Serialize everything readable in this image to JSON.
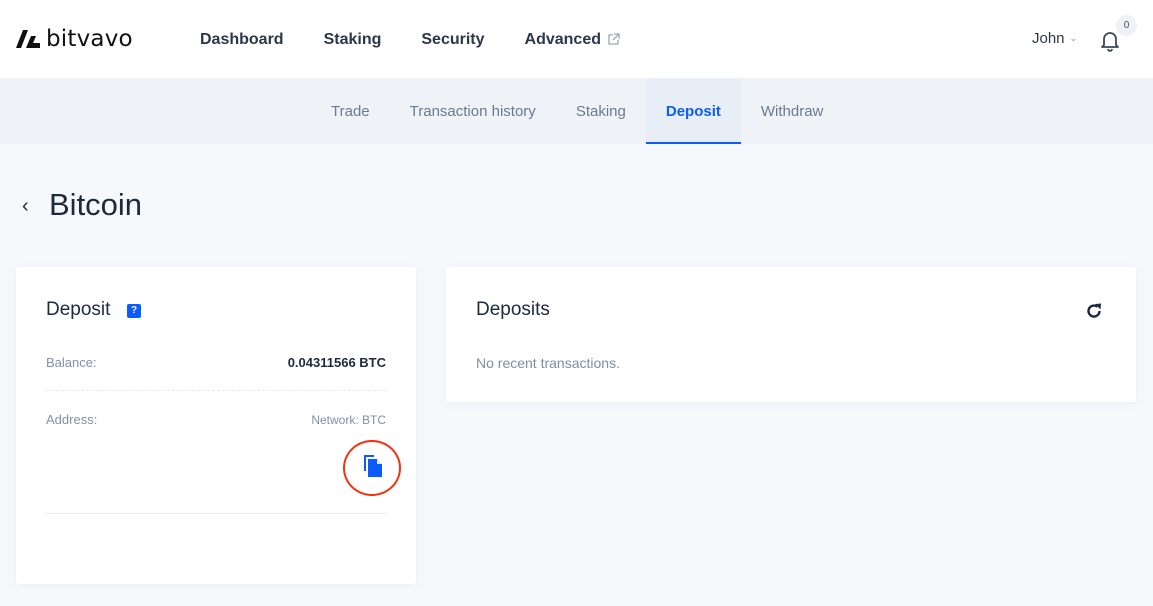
{
  "header": {
    "brand": "bitvavo",
    "nav": [
      {
        "label": "Dashboard"
      },
      {
        "label": "Staking"
      },
      {
        "label": "Security"
      },
      {
        "label": "Advanced",
        "icon": "external-link-icon"
      }
    ],
    "user": {
      "name": "John",
      "icon": "chevron-down-icon"
    },
    "notifications": {
      "icon": "bell-icon",
      "count": "0"
    }
  },
  "subnav": {
    "tabs": [
      {
        "label": "Trade",
        "active": false
      },
      {
        "label": "Transaction history",
        "active": false
      },
      {
        "label": "Staking",
        "active": false
      },
      {
        "label": "Deposit",
        "active": true
      },
      {
        "label": "Withdraw",
        "active": false
      }
    ]
  },
  "page": {
    "back_icon": "chevron-left-icon",
    "title": "Bitcoin"
  },
  "deposit_card": {
    "title": "Deposit",
    "help_label": "?",
    "balance_label": "Balance:",
    "balance_value": "0.04311566 BTC",
    "address_label": "Address:",
    "network_label": "Network: BTC",
    "copy_icon": "copy-icon"
  },
  "deposits_card": {
    "title": "Deposits",
    "empty_message": "No recent transactions.",
    "refresh_icon": "refresh-icon"
  },
  "colors": {
    "accent": "#0a5cff",
    "highlight_ring": "#f0320f",
    "page_background": "#f5f9fc"
  }
}
